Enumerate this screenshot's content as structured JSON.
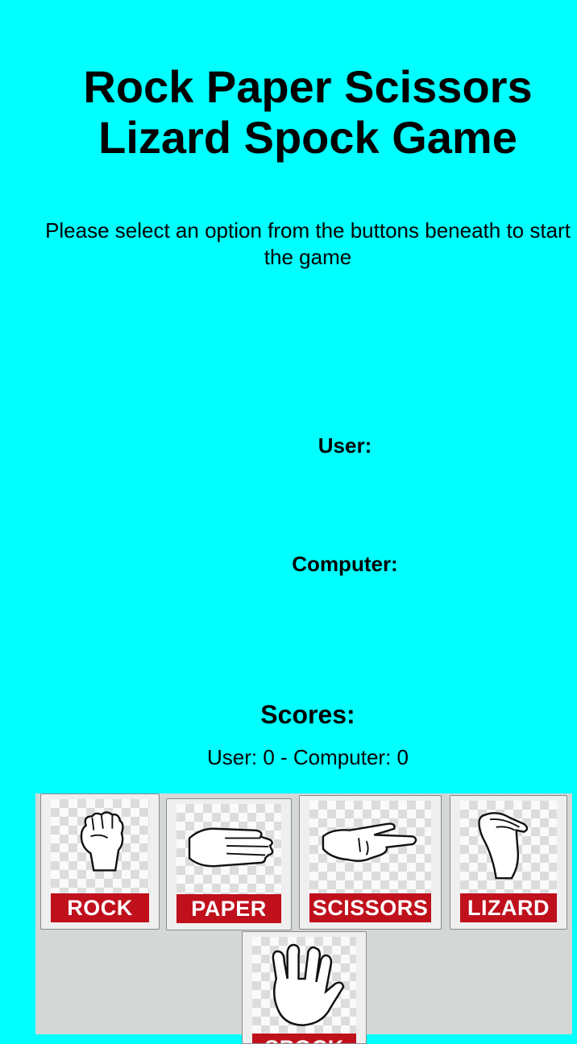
{
  "title_line1": "Rock Paper Scissors",
  "title_line2": "Lizard Spock Game",
  "instructions": "Please select an option from the buttons beneath to start the game",
  "user_label": "User:",
  "computer_label": "Computer:",
  "scores_heading": "Scores:",
  "scores_line": "User: 0 - Computer: 0",
  "options": [
    {
      "label": "ROCK",
      "icon": "fist-icon"
    },
    {
      "label": "PAPER",
      "icon": "flat-hand-icon"
    },
    {
      "label": "SCISSORS",
      "icon": "scissors-hand-icon"
    },
    {
      "label": "LIZARD",
      "icon": "lizard-hand-icon"
    },
    {
      "label": "SPOCK",
      "icon": "vulcan-salute-icon"
    }
  ],
  "colors": {
    "background": "#00ffff",
    "panel": "#d3d7d6",
    "banner": "#c0101c"
  }
}
